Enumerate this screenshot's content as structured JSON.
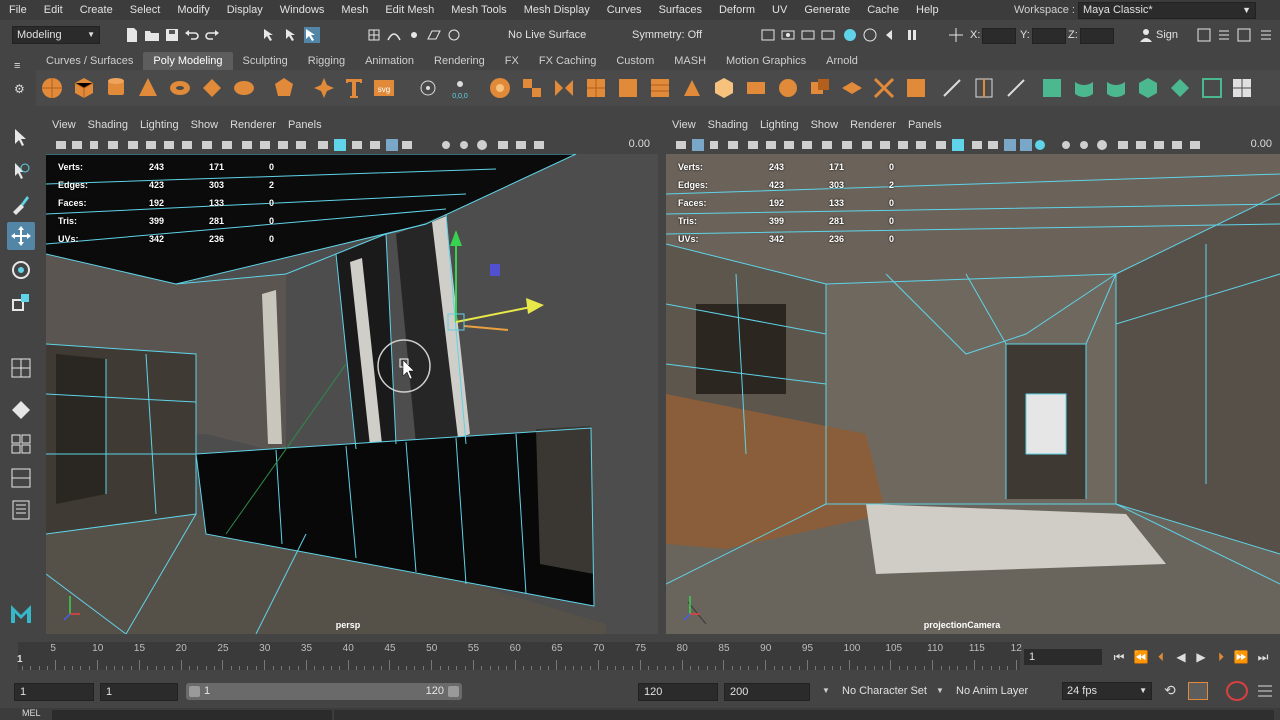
{
  "menubar": {
    "items": [
      "File",
      "Edit",
      "Create",
      "Select",
      "Modify",
      "Display",
      "Windows",
      "Mesh",
      "Edit Mesh",
      "Mesh Tools",
      "Mesh Display",
      "Curves",
      "Surfaces",
      "Deform",
      "UV",
      "Generate",
      "Cache",
      "Help"
    ],
    "workspace_label": "Workspace :",
    "workspace_value": "Maya Classic*"
  },
  "statusline": {
    "mode": "Modeling",
    "live_surface": "No Live Surface",
    "symmetry": "Symmetry: Off",
    "x_label": "X:",
    "y_label": "Y:",
    "z_label": "Z:",
    "sign_in": "Sign"
  },
  "shelf": {
    "tabs": [
      "Curves / Surfaces",
      "Poly Modeling",
      "Sculpting",
      "Rigging",
      "Animation",
      "Rendering",
      "FX",
      "FX Caching",
      "Custom",
      "MASH",
      "Motion Graphics",
      "Arnold"
    ],
    "active_tab": "Poly Modeling"
  },
  "viewport_left": {
    "menu": [
      "View",
      "Shading",
      "Lighting",
      "Show",
      "Renderer",
      "Panels"
    ],
    "zoom": "0.00",
    "camera": "persp",
    "hud": {
      "labels": [
        "Verts:",
        "Edges:",
        "Faces:",
        "Tris:",
        "UVs:"
      ],
      "col1": [
        "243",
        "423",
        "192",
        "399",
        "342"
      ],
      "col2": [
        "171",
        "303",
        "133",
        "281",
        "236"
      ],
      "col3": [
        "0",
        "2",
        "0",
        "0",
        "0"
      ]
    }
  },
  "viewport_right": {
    "menu": [
      "View",
      "Shading",
      "Lighting",
      "Show",
      "Renderer",
      "Panels"
    ],
    "zoom": "0.00",
    "camera": "projectionCamera",
    "hud": {
      "labels": [
        "Verts:",
        "Edges:",
        "Faces:",
        "Tris:",
        "UVs:"
      ],
      "col1": [
        "243",
        "423",
        "192",
        "399",
        "342"
      ],
      "col2": [
        "171",
        "303",
        "133",
        "281",
        "236"
      ],
      "col3": [
        "0",
        "2",
        "0",
        "0",
        "0"
      ]
    }
  },
  "timeline": {
    "ticks": [
      "5",
      "10",
      "15",
      "20",
      "25",
      "30",
      "35",
      "40",
      "45",
      "50",
      "55",
      "60",
      "65",
      "70",
      "75",
      "80",
      "85",
      "90",
      "95",
      "100",
      "105",
      "110",
      "115",
      "12"
    ],
    "current_frame_marker": "1",
    "current_frame": "1"
  },
  "range": {
    "start": "1",
    "playback_start": "1",
    "slider_start": "1",
    "slider_end": "120",
    "playback_end": "120",
    "end": "200",
    "character_set": "No Character Set",
    "anim_layer": "No Anim Layer",
    "fps": "24 fps"
  },
  "helpline": {
    "text": "MEL"
  },
  "colors": {
    "accent": "#5285a6",
    "wire": "#5fd3e8",
    "shelf_icon": "#e08a3a",
    "shelf_icon_green": "#4cb890"
  }
}
